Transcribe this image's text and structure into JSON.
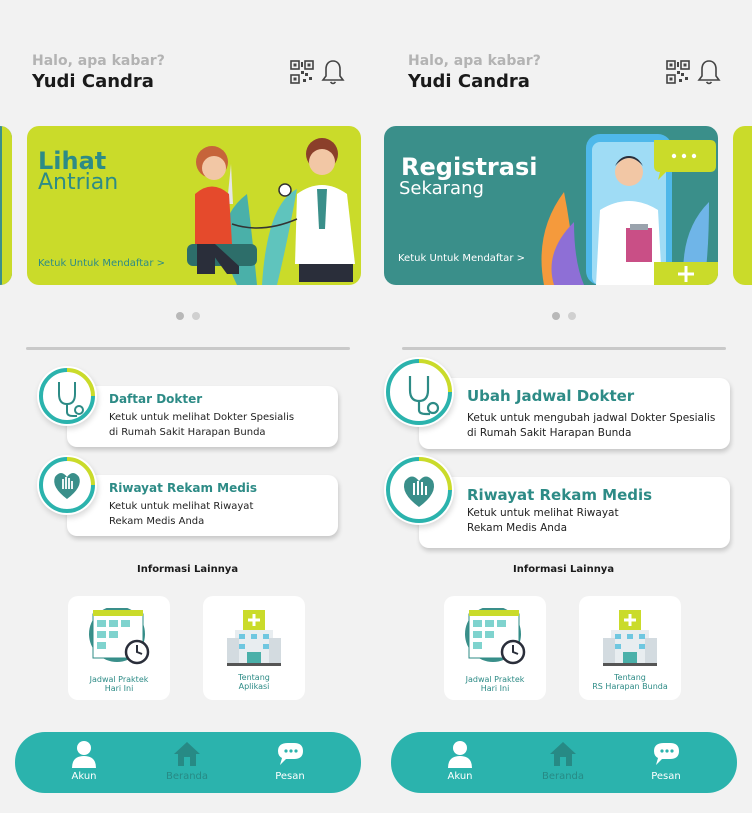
{
  "header": {
    "greeting": "Halo, apa kabar?",
    "username": "Yudi Candra",
    "qr_icon": "qr-code-icon",
    "bell_icon": "bell-icon"
  },
  "screens": [
    {
      "banner": {
        "title_bold": "Lihat",
        "title_light": "Antrian",
        "cta": "Ketuk Untuk Mendaftar >",
        "bg": "#cadb2a"
      },
      "cards": [
        {
          "title": "Daftar Dokter",
          "desc_line1": "Ketuk untuk melihat Dokter Spesialis",
          "desc_line2": "di Rumah Sakit Harapan Bunda",
          "icon": "stethoscope-icon"
        },
        {
          "title": "Riwayat Rekam Medis",
          "desc_line1": "Ketuk untuk melihat Riwayat",
          "desc_line2": "Rekam Medis Anda",
          "icon": "heart-hand-icon"
        }
      ],
      "info_heading": "Informasi Lainnya",
      "tiles": [
        {
          "line1": "Jadwal Praktek",
          "line2": "Hari Ini",
          "icon": "schedule-calendar-icon"
        },
        {
          "line1": "Tentang",
          "line2": "Aplikasi",
          "icon": "hospital-building-icon"
        }
      ]
    },
    {
      "banner": {
        "title_bold": "Registrasi",
        "title_light": "Sekarang",
        "cta": "Ketuk Untuk Mendaftar >",
        "bg": "#3a8f8a"
      },
      "cards": [
        {
          "title": "Ubah Jadwal Dokter",
          "desc_line1": "Ketuk untuk mengubah jadwal Dokter Spesialis",
          "desc_line2": "di Rumah Sakit Harapan Bunda",
          "icon": "stethoscope-icon"
        },
        {
          "title": "Riwayat Rekam Medis",
          "desc_line1": "Ketuk untuk melihat Riwayat",
          "desc_line2": "Rekam Medis Anda",
          "icon": "heart-hand-icon"
        }
      ],
      "info_heading": "Informasi Lainnya",
      "tiles": [
        {
          "line1": "Jadwal Praktek",
          "line2": "Hari Ini",
          "icon": "schedule-calendar-icon"
        },
        {
          "line1": "Tentang",
          "line2": "RS Harapan Bunda",
          "icon": "hospital-building-icon"
        }
      ]
    }
  ],
  "nav": {
    "items": [
      {
        "label": "Akun",
        "icon": "user-icon"
      },
      {
        "label": "Beranda",
        "icon": "home-icon"
      },
      {
        "label": "Pesan",
        "icon": "chat-icon"
      }
    ]
  },
  "colors": {
    "accent": "#2bb3ad",
    "teal_dark": "#2d8b86",
    "lime": "#cadb2a"
  }
}
